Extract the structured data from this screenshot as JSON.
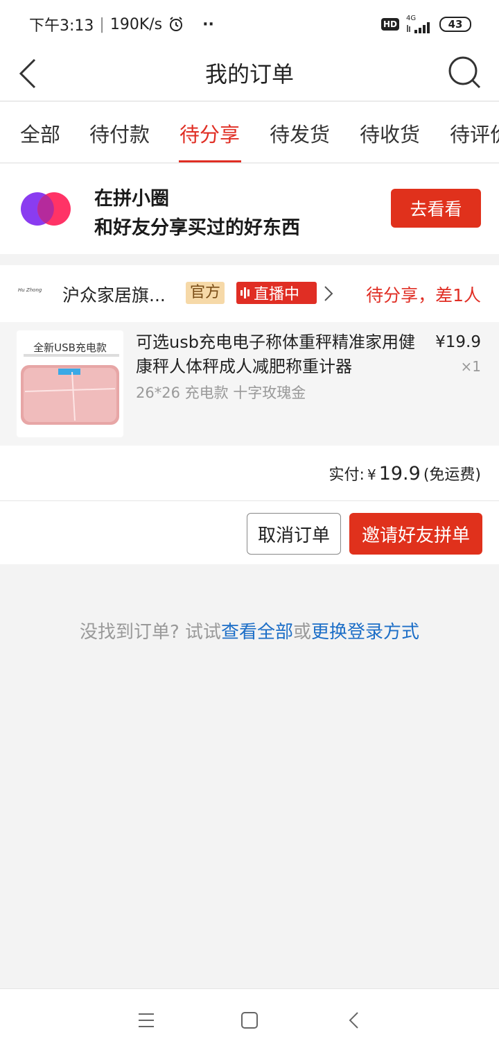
{
  "status_bar": {
    "time": "下午3:13",
    "speed": "190K/s",
    "dots": "··",
    "hd": "HD",
    "network": "4G",
    "battery": "43"
  },
  "nav": {
    "title": "我的订单"
  },
  "tabs": [
    {
      "label": "全部",
      "active": false
    },
    {
      "label": "待付款",
      "active": false
    },
    {
      "label": "待分享",
      "active": true
    },
    {
      "label": "待发货",
      "active": false
    },
    {
      "label": "待收货",
      "active": false
    },
    {
      "label": "待评价",
      "active": false
    }
  ],
  "circle_banner": {
    "title": "在拼小圈",
    "subtitle": "和好友分享买过的好东西",
    "button": "去看看"
  },
  "order": {
    "shop_logo_text": "Hu Zhong",
    "shop_name": "沪众家居旗...",
    "badge_official": "官方",
    "badge_live": "直播中",
    "status": "待分享，差1人",
    "item": {
      "image_caption": "全新USB充电款",
      "title": "可选usb充电电子称体重秤精准家用健康秤人体秤成人减肥称重计器",
      "spec": "26*26 充电款 十字玫瑰金",
      "price": "¥19.9",
      "quantity": "×1"
    },
    "payment": {
      "label": "实付:",
      "currency": "¥",
      "amount": "19.9",
      "note": "(免运费)"
    },
    "actions": {
      "cancel": "取消订单",
      "invite": "邀请好友拼单"
    }
  },
  "empty_hint": {
    "prefix": "没找到订单? 试试",
    "link_all": "查看全部",
    "or": "或",
    "link_login": "更换登录方式"
  },
  "colors": {
    "accent": "#e02e24",
    "link": "#1c6ec7",
    "background": "#f3f3f3"
  }
}
